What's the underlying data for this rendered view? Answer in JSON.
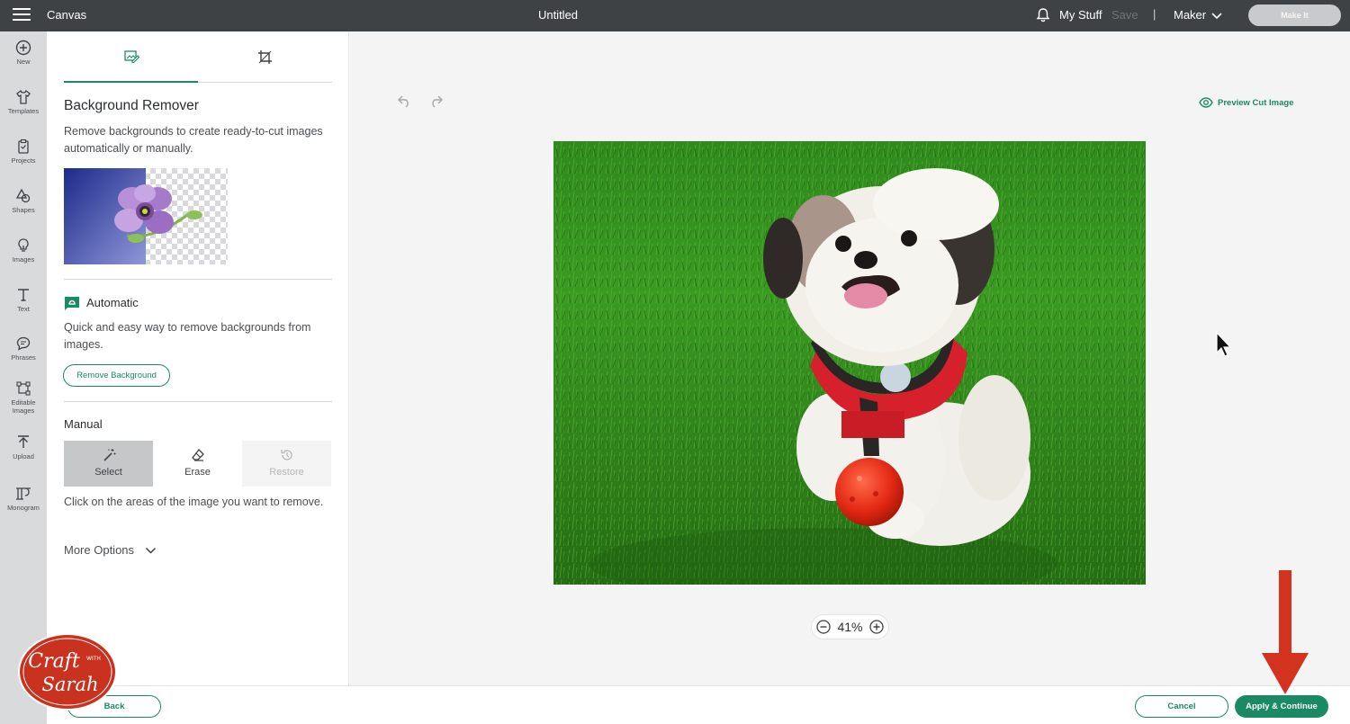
{
  "topbar": {
    "app_title": "Canvas",
    "doc_title": "Untitled",
    "my_stuff": "My Stuff",
    "save": "Save",
    "separator": "|",
    "machine": "Maker",
    "make_it": "Make It"
  },
  "rail": {
    "items": [
      {
        "label": "New",
        "icon": "plus-circle-icon"
      },
      {
        "label": "Templates",
        "icon": "shirt-icon"
      },
      {
        "label": "Projects",
        "icon": "clipboard-icon"
      },
      {
        "label": "Shapes",
        "icon": "shapes-icon"
      },
      {
        "label": "Images",
        "icon": "lightbulb-icon"
      },
      {
        "label": "Text",
        "icon": "text-icon"
      },
      {
        "label": "Phrases",
        "icon": "speech-bubble-icon"
      },
      {
        "label": "Editable Images",
        "icon": "editable-images-icon"
      },
      {
        "label": "Upload",
        "icon": "upload-icon"
      },
      {
        "label": "Monogram",
        "icon": "monogram-icon"
      }
    ]
  },
  "panel": {
    "title": "Background Remover",
    "description": "Remove backgrounds to create ready-to-cut images automatically or manually.",
    "automatic": {
      "label": "Automatic",
      "description": "Quick and easy way to remove backgrounds from images.",
      "button": "Remove Background"
    },
    "manual": {
      "label": "Manual",
      "tools": [
        {
          "label": "Select",
          "state": "active"
        },
        {
          "label": "Erase",
          "state": "normal"
        },
        {
          "label": "Restore",
          "state": "disabled"
        }
      ],
      "description": "Click on the areas of the image you want to remove."
    },
    "more_options": "More Options"
  },
  "canvas": {
    "preview_cut": "Preview Cut Image",
    "zoom": "41%"
  },
  "footer": {
    "back": "Back",
    "cancel": "Cancel",
    "apply": "Apply & Continue"
  },
  "watermark": {
    "text": "Craft with Sarah"
  },
  "colors": {
    "accent": "#1a8a65",
    "topbar": "#3f4245",
    "rail": "#d9dadb",
    "canvas_bg": "#f4f4f5",
    "annotation_arrow": "#d3321f",
    "logo_red": "#c8321f"
  }
}
